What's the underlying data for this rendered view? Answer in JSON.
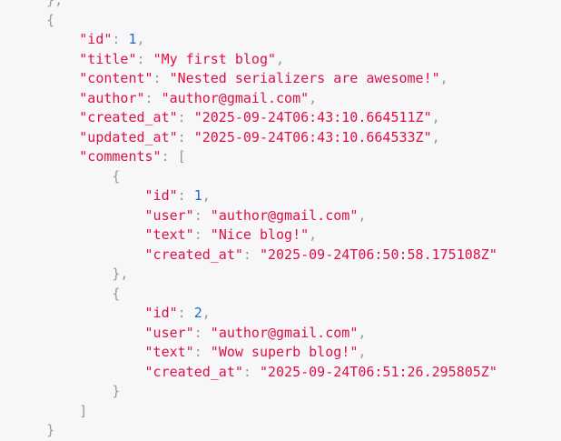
{
  "colors": {
    "background": "#f7f7f9",
    "key": "#dd1144",
    "string": "#dd1144",
    "number": "#1a6dc2",
    "punctuation": "#999999"
  },
  "blog": {
    "id": "1",
    "title": "My first blog",
    "content": "Nested serializers are awesome!",
    "author": "author@gmail.com",
    "created_at": "2025-09-24T06:43:10.664511Z",
    "updated_at": "2025-09-24T06:43:10.664533Z",
    "comments": [
      {
        "id": "1",
        "user": "author@gmail.com",
        "text": "Nice blog!",
        "created_at": "2025-09-24T06:50:58.175108Z"
      },
      {
        "id": "2",
        "user": "author@gmail.com",
        "text": "Wow superb blog!",
        "created_at": "2025-09-24T06:51:26.295805Z"
      }
    ]
  }
}
